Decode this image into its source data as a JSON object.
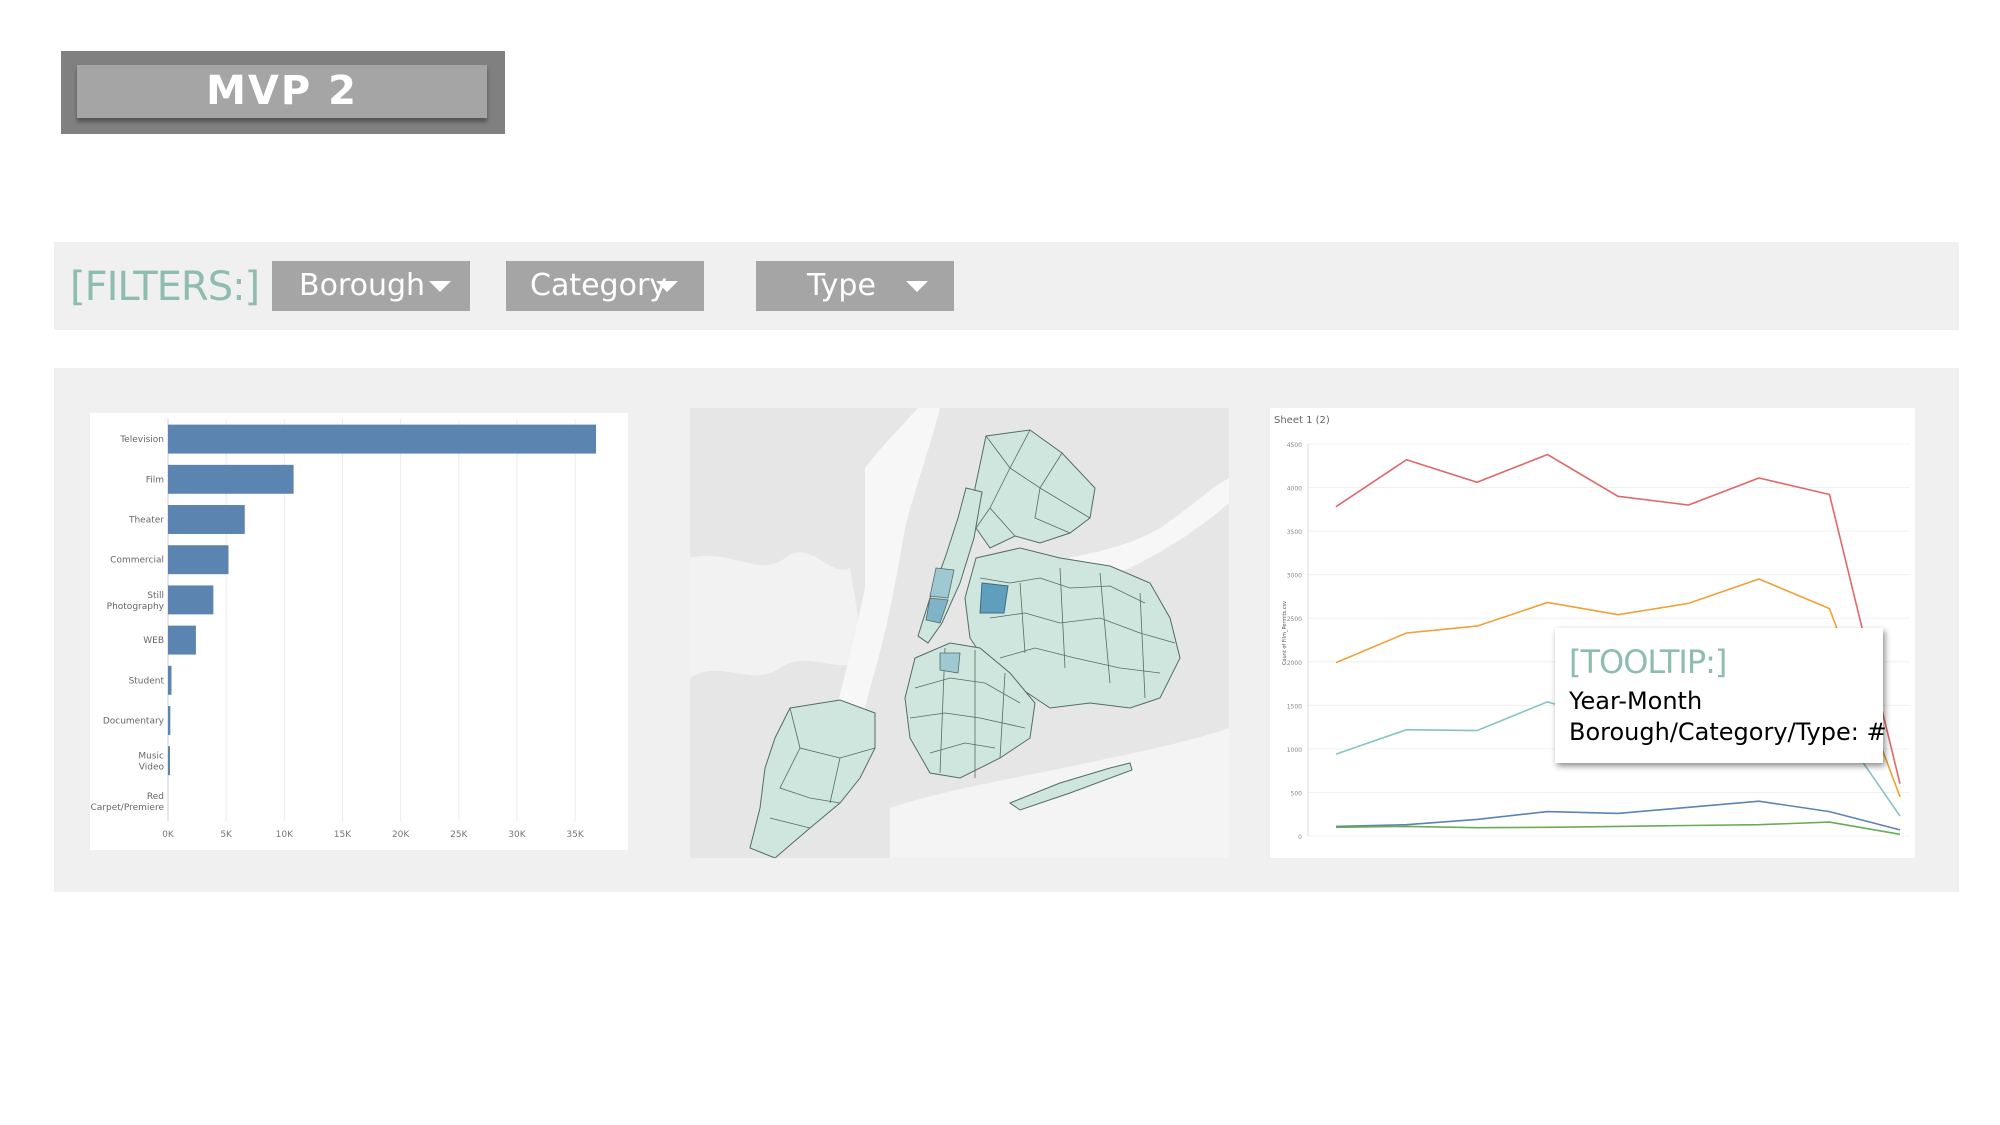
{
  "header": {
    "title": "MVP 2"
  },
  "filters": {
    "label": "[FILTERS:]",
    "dropdowns": [
      {
        "label": "Borough"
      },
      {
        "label": "Category"
      },
      {
        "label": "Type"
      }
    ]
  },
  "map": {
    "fill_color": "#cfe6df",
    "highlight_color": "#5f9fbd",
    "land_color": "#e0e0e0"
  },
  "tooltip": {
    "heading": "[TOOLTIP:]",
    "line1": "Year-Month",
    "line2": "Borough/Category/Type: #"
  },
  "chart_data": [
    {
      "type": "bar",
      "orientation": "horizontal",
      "categories": [
        "Television",
        "Film",
        "Theater",
        "Commercial",
        "Still Photography",
        "WEB",
        "Student",
        "Documentary",
        "Music Video",
        "Red Carpet/Premiere"
      ],
      "values": [
        36800,
        10800,
        6600,
        5200,
        3900,
        2400,
        300,
        200,
        150,
        0
      ],
      "xlim": [
        0,
        38000
      ],
      "x_ticks": [
        "0K",
        "5K",
        "10K",
        "15K",
        "20K",
        "25K",
        "30K",
        "35K"
      ],
      "x_tick_values": [
        0,
        5000,
        10000,
        15000,
        20000,
        25000,
        30000,
        35000
      ],
      "grid": true,
      "colors": {
        "bar": "#5b84b1"
      }
    },
    {
      "type": "line",
      "title": "Sheet 1 (2)",
      "ylabel": "Count of Film_Permits.csv",
      "ylim": [
        0,
        4500
      ],
      "y_ticks": [
        "0",
        "500",
        "1000",
        "1500",
        "2000",
        "2500",
        "3000",
        "3500",
        "4000",
        "4500"
      ],
      "y_tick_values": [
        0,
        500,
        1000,
        1500,
        2000,
        2500,
        3000,
        3500,
        4000,
        4500
      ],
      "x": [
        1,
        2,
        3,
        4,
        5,
        6,
        7,
        8,
        9
      ],
      "series": [
        {
          "color": "#e0686a",
          "values": [
            3780,
            4320,
            4060,
            4380,
            3900,
            3800,
            4110,
            3920,
            600
          ]
        },
        {
          "color": "#f0a035",
          "values": [
            1990,
            2330,
            2410,
            2680,
            2540,
            2670,
            2950,
            2610,
            450
          ]
        },
        {
          "color": "#88c3c3",
          "values": [
            940,
            1220,
            1210,
            1540,
            1300,
            1400,
            1520,
            1400,
            230
          ]
        },
        {
          "color": "#5b84b1",
          "values": [
            110,
            130,
            190,
            280,
            260,
            330,
            400,
            280,
            70
          ]
        },
        {
          "color": "#6aab58",
          "values": [
            100,
            110,
            95,
            100,
            110,
            120,
            130,
            160,
            20
          ]
        }
      ],
      "grid": true
    }
  ]
}
